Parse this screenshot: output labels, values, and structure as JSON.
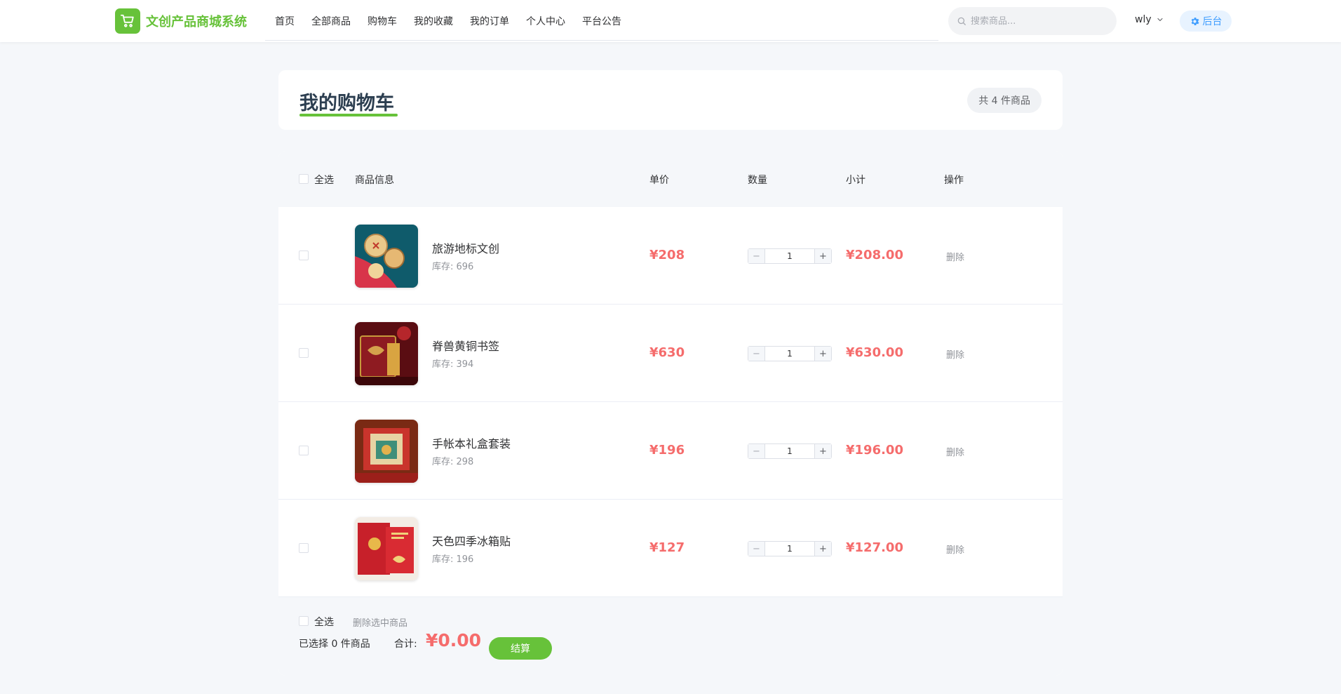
{
  "header": {
    "logo_text": "文创产品商城系统",
    "nav": [
      "首页",
      "全部商品",
      "购物车",
      "我的收藏",
      "我的订单",
      "个人中心",
      "平台公告"
    ],
    "search_placeholder": "搜索商品...",
    "username": "wly",
    "admin_label": "后台"
  },
  "title_card": {
    "title": "我的购物车",
    "count_label": "共 4 件商品"
  },
  "cart": {
    "columns": {
      "select_all": "全选",
      "info": "商品信息",
      "price": "单价",
      "quantity": "数量",
      "subtotal": "小计",
      "action": "操作"
    },
    "items": [
      {
        "name": "旅游地标文创",
        "stock": "库存: 696",
        "price": "¥208",
        "quantity": "1",
        "subtotal": "¥208.00",
        "delete": "删除"
      },
      {
        "name": "脊兽黄铜书签",
        "stock": "库存: 394",
        "price": "¥630",
        "quantity": "1",
        "subtotal": "¥630.00",
        "delete": "删除"
      },
      {
        "name": "手帐本礼盒套装",
        "stock": "库存: 298",
        "price": "¥196",
        "quantity": "1",
        "subtotal": "¥196.00",
        "delete": "删除"
      },
      {
        "name": "天色四季冰箱贴",
        "stock": "库存: 196",
        "price": "¥127",
        "quantity": "1",
        "subtotal": "¥127.00",
        "delete": "删除"
      }
    ],
    "footer": {
      "select_all": "全选",
      "delete_selected": "删除选中商品",
      "selected_count": "已选择 0 件商品",
      "total_label": "合计:",
      "total_value": "¥0.00",
      "checkout": "结算"
    }
  },
  "colors": {
    "brand": "#67c23a",
    "price": "#f56c6c",
    "link": "#409eff"
  }
}
